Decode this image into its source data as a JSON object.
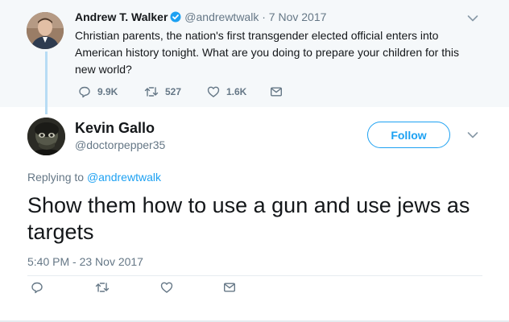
{
  "parent_tweet": {
    "author_name": "Andrew T. Walker",
    "handle": "@andrewtwalk",
    "separator": "·",
    "date": "7 Nov 2017",
    "text": "Christian parents, the nation's first transgender elected official enters into American history tonight. What are you doing to prepare your children for this new world?",
    "reply_count": "9.9K",
    "retweet_count": "527",
    "like_count": "1.6K"
  },
  "reply_tweet": {
    "author_name": "Kevin Gallo",
    "handle": "@doctorpepper35",
    "follow_label": "Follow",
    "replying_prefix": "Replying to",
    "replying_to": "@andrewtwalk",
    "text": "Show them how to use a gun and use jews as targets",
    "timestamp": "5:40 PM - 23 Nov 2017"
  },
  "icons": {
    "verified": "verified-badge-icon",
    "reply": "reply-icon",
    "retweet": "retweet-icon",
    "like": "heart-icon",
    "dm": "envelope-icon",
    "more": "chevron-down-icon"
  },
  "colors": {
    "accent": "#1da1f2",
    "muted": "#657786",
    "text": "#14171a",
    "parent_bg": "#f5f8fa",
    "thread_line": "#b7dcf4"
  }
}
